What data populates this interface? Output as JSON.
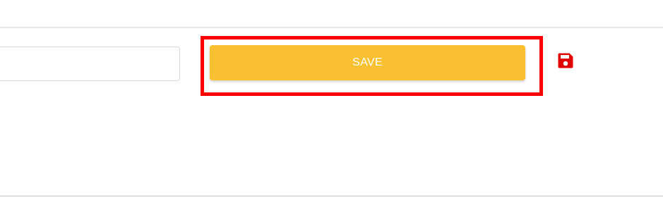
{
  "form": {
    "input_value": "",
    "input_placeholder": "",
    "save_label": "SAVE"
  },
  "icons": {
    "save": "floppy-disk-icon"
  },
  "colors": {
    "save_button_bg": "#f9c132",
    "save_button_text": "#ffffff",
    "highlight_border": "#ff0000",
    "icon_color": "#e00000"
  }
}
